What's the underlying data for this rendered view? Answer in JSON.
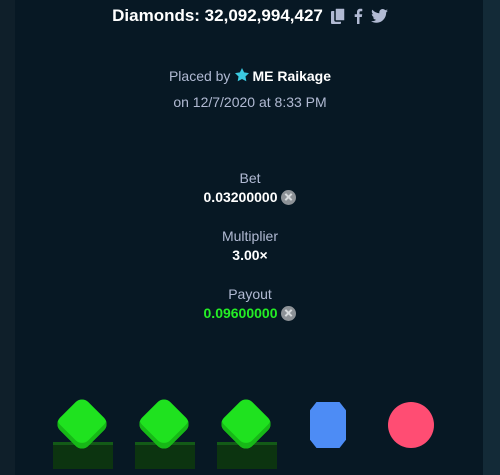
{
  "header": {
    "title": "Diamonds: 32,092,994,427"
  },
  "placed": {
    "prefix": "Placed by",
    "user": "ME Raikage",
    "date_line": "on 12/7/2020 at 8:33 PM"
  },
  "stats": {
    "bet_label": "Bet",
    "bet_value": "0.03200000",
    "multiplier_label": "Multiplier",
    "multiplier_value": "3.00×",
    "payout_label": "Payout",
    "payout_value": "0.09600000"
  },
  "tiles": [
    {
      "gem": "green-diamond",
      "color": "#1fe21f"
    },
    {
      "gem": "green-diamond",
      "color": "#1fe21f"
    },
    {
      "gem": "green-diamond",
      "color": "#1fe21f"
    },
    {
      "gem": "blue-sapphire",
      "color": "#4d8cf5"
    },
    {
      "gem": "red-ruby",
      "color": "#ff4d73"
    }
  ],
  "colors": {
    "background": "#071824",
    "label": "#b1bad3",
    "payout": "#24ee25",
    "star": "#3bc9e0"
  },
  "icons": [
    "copy-icon",
    "facebook-icon",
    "twitter-icon",
    "star-icon",
    "coin-icon"
  ]
}
